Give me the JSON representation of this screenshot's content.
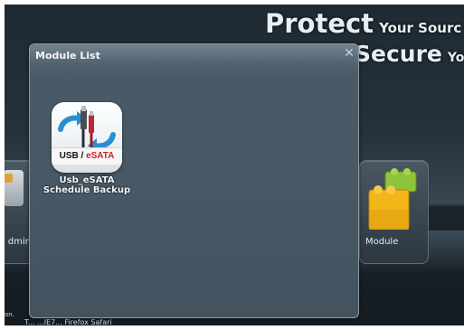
{
  "tagline": {
    "line1_big": "Protect",
    "line1_small": "Your Sourc",
    "line2_big": "Secure",
    "line2_small": "Yo"
  },
  "background_tiles": [
    {
      "label": "dmin"
    },
    {
      "label": "Module"
    }
  ],
  "bottom_text": {
    "left_fragment": "on.",
    "footer_fragment": "T...                                                                                    ...IE7... Firefox Safari"
  },
  "dialog": {
    "title": "Module List",
    "close_glyph": "✕",
    "modules": [
      {
        "name_line1": "Usb_eSATA",
        "name_line2": "Schedule Backup",
        "icon_label_usb": "USB / ",
        "icon_label_esata": "eSATA",
        "icon": "usb-esata-backup-icon"
      }
    ]
  },
  "colors": {
    "accent_blue": "#2a8fd0",
    "esata_red": "#d0212a",
    "dialog_bg": "#4b5c68"
  }
}
